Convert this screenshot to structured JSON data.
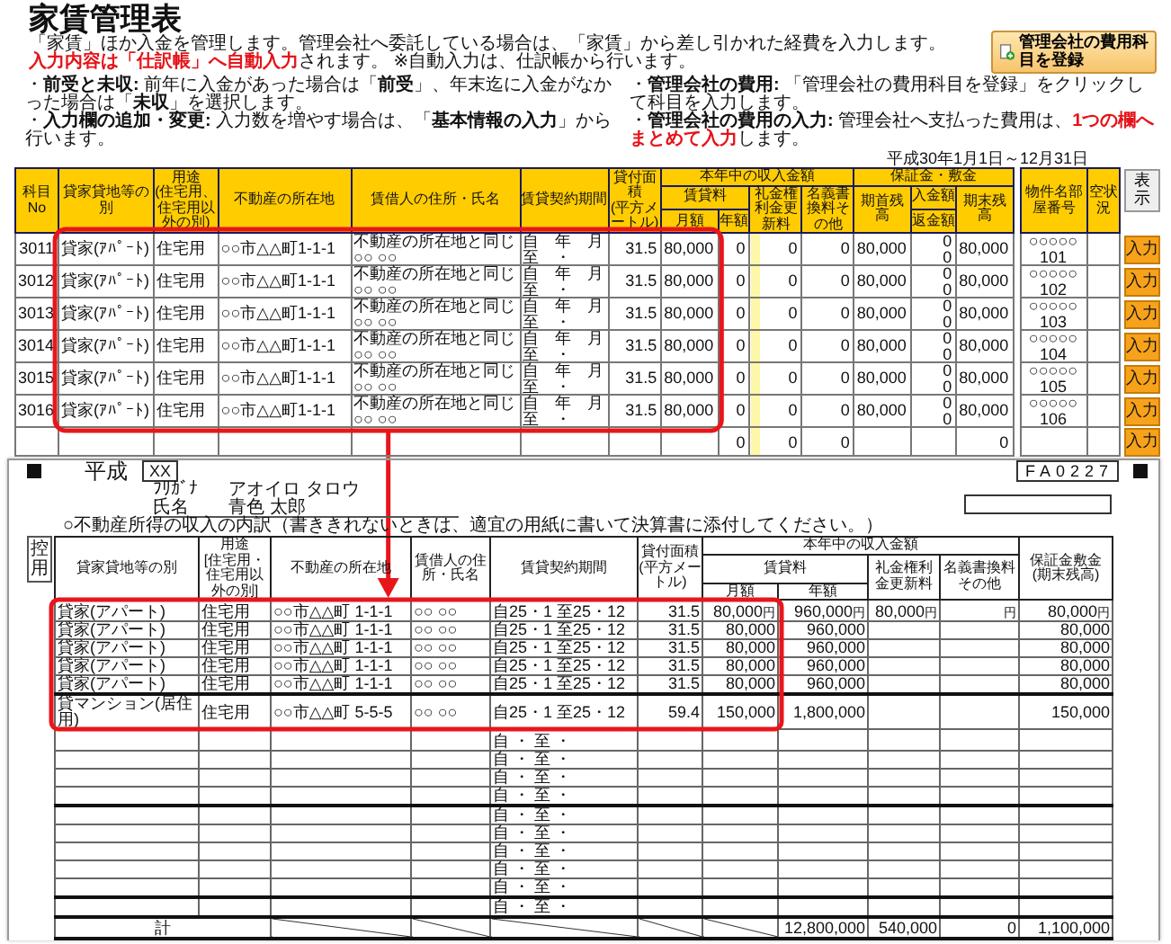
{
  "ledger": {
    "title": "家賃管理表",
    "notes": [
      {
        "text": "「家賃」ほか入金を管理します。管理会社へ委託している場合は、「家賃」から差し引かれた経費を入力します。"
      },
      {
        "emphasis": "入力内容は「仕訳帳」へ自動入力",
        "text": "されます。 ※自動入力は、仕訳帳から行います。"
      }
    ],
    "register_button": "管理会社の費用科目を登録",
    "bullets": [
      {
        "mark": "・",
        "label": "前受と未収:",
        "text": "前年に入金があった場合は「**前受**」、年末迄に入金がなかった場合は「**未収**」を選択します。"
      },
      {
        "mark": "・",
        "label": "入力欄の追加・変更:",
        "text": "入力数を増やす場合は、「**基本情報の入力**」から行います。"
      },
      {
        "mark": "・",
        "label": "管理会社の費用:",
        "text": "「管理会社の費用科目を登録」をクリックして科目を入力します。"
      },
      {
        "mark": "・",
        "label": "管理会社の費用の入力:",
        "text": "管理会社へ支払った費用は、",
        "emphasis": "1つの欄へまとめて入力",
        "text_after": "します。"
      }
    ],
    "period": "平成30年1月1日～12月31日",
    "show_button": "表示",
    "columns": {
      "no": "科目No",
      "type": "貸家貸地等の別",
      "use": "用途",
      "use_note": "(住宅用、住宅用以外の別)",
      "address": "不動産の所在地",
      "tenant": "賃借人の住所・氏名",
      "period": "賃貸契約期間",
      "area": "貸付面積",
      "area_unit": "(平方メートル)",
      "income": "本年中の収入金額",
      "rent": "賃貸料",
      "monthly": "月額",
      "yearly": "年額",
      "key_money": "礼金権利金更新料",
      "transfer_fee": "名義書換料その他",
      "deposit": "保証金・敷金",
      "opening": "期首残高",
      "received": "入金額",
      "refunded": "返金額",
      "closing": "期末残高",
      "property": "物件名部屋番号",
      "vacancy": "空状況"
    },
    "rows": [
      {
        "no": "3011",
        "type": "貸家(ｱﾊﾟｰﾄ)",
        "use": "住宅用",
        "address": "○○市△△町1-1-1",
        "tenant": "不動産の所在地と同じ",
        "tenant_name": "○○ ○○",
        "period_from": "自　年　月",
        "period_to": "至　・",
        "area": "31.5",
        "monthly": "80,000",
        "yearly": "0",
        "key_money": "0",
        "transfer_fee": "0",
        "opening": "80,000",
        "received": "0",
        "refunded": "0",
        "closing": "80,000",
        "property": "○○○○○",
        "room": "101",
        "action": "入力"
      },
      {
        "no": "3012",
        "type": "貸家(ｱﾊﾟｰﾄ)",
        "use": "住宅用",
        "address": "○○市△△町1-1-1",
        "tenant": "不動産の所在地と同じ",
        "tenant_name": "○○ ○○",
        "period_from": "自　年　月",
        "period_to": "至　・",
        "area": "31.5",
        "monthly": "80,000",
        "yearly": "0",
        "key_money": "0",
        "transfer_fee": "0",
        "opening": "80,000",
        "received": "0",
        "refunded": "0",
        "closing": "80,000",
        "property": "○○○○○",
        "room": "102",
        "action": "入力"
      },
      {
        "no": "3013",
        "type": "貸家(ｱﾊﾟｰﾄ)",
        "use": "住宅用",
        "address": "○○市△△町1-1-1",
        "tenant": "不動産の所在地と同じ",
        "tenant_name": "○○ ○○",
        "period_from": "自　年　月",
        "period_to": "至　・",
        "area": "31.5",
        "monthly": "80,000",
        "yearly": "0",
        "key_money": "0",
        "transfer_fee": "0",
        "opening": "80,000",
        "received": "0",
        "refunded": "0",
        "closing": "80,000",
        "property": "○○○○○",
        "room": "103",
        "action": "入力"
      },
      {
        "no": "3014",
        "type": "貸家(ｱﾊﾟｰﾄ)",
        "use": "住宅用",
        "address": "○○市△△町1-1-1",
        "tenant": "不動産の所在地と同じ",
        "tenant_name": "○○ ○○",
        "period_from": "自　年　月",
        "period_to": "至　・",
        "area": "31.5",
        "monthly": "80,000",
        "yearly": "0",
        "key_money": "0",
        "transfer_fee": "0",
        "opening": "80,000",
        "received": "0",
        "refunded": "0",
        "closing": "80,000",
        "property": "○○○○○",
        "room": "104",
        "action": "入力"
      },
      {
        "no": "3015",
        "type": "貸家(ｱﾊﾟｰﾄ)",
        "use": "住宅用",
        "address": "○○市△△町1-1-1",
        "tenant": "不動産の所在地と同じ",
        "tenant_name": "○○ ○○",
        "period_from": "自　年　月",
        "period_to": "至　・",
        "area": "31.5",
        "monthly": "80,000",
        "yearly": "0",
        "key_money": "0",
        "transfer_fee": "0",
        "opening": "80,000",
        "received": "0",
        "refunded": "0",
        "closing": "80,000",
        "property": "○○○○○",
        "room": "105",
        "action": "入力"
      },
      {
        "no": "3016",
        "type": "貸家(ｱﾊﾟｰﾄ)",
        "use": "住宅用",
        "address": "○○市△△町1-1-1",
        "tenant": "不動産の所在地と同じ",
        "tenant_name": "○○ ○○",
        "period_from": "自　年　月",
        "period_to": "至　・",
        "area": "31.5",
        "monthly": "80,000",
        "yearly": "0",
        "key_money": "0",
        "transfer_fee": "0",
        "opening": "80,000",
        "received": "0",
        "refunded": "0",
        "closing": "80,000",
        "property": "○○○○○",
        "room": "106",
        "action": "入力"
      },
      {
        "yearly": "0",
        "key_money": "0",
        "transfer_fee": "0",
        "closing": "0",
        "action": "入力"
      }
    ]
  },
  "form": {
    "era": "平成",
    "year": "XX",
    "code": "FA0227",
    "furigana_label": "ﾌﾘｶﾞﾅ",
    "furigana": "アオイロ タロウ",
    "name_label": "氏名",
    "name": "青色 太郎",
    "note": "○不動産所得の収入の内訳（書ききれないときは、適宜の用紙に書いて決算書に添付してください。）",
    "copy_label": "控用",
    "columns": {
      "type": "貸家貸地等の別",
      "use": "用途",
      "use_note": "[住宅用・住宅用以外の別]",
      "address": "不動産の所在地",
      "tenant": "賃借人の住所・氏名",
      "period": "賃貸契約期間",
      "area": "貸付面積",
      "area_unit": "(平方メートル)",
      "income": "本年中の収入金額",
      "rent": "賃貸料",
      "monthly": "月額",
      "yearly": "年額",
      "key_money": "礼金権利金更新料",
      "other": "名義書換料その他",
      "deposit": "保証金敷金",
      "deposit_note": "(期末残高)"
    },
    "rows": [
      {
        "type": "貸家(アパート)",
        "use": "住宅用",
        "address": "○○市△△町 1-1-1",
        "tenant": "○○ ○○",
        "period": "自25・1 至25・12",
        "area": "31.5",
        "monthly": "80,000",
        "yearly": "960,000",
        "key_money": "80,000",
        "deposit": "80,000",
        "monthly_unit": "円",
        "yearly_unit": "円",
        "key_money_unit": "円",
        "other_unit": "円",
        "deposit_unit": "円"
      },
      {
        "type": "貸家(アパート)",
        "use": "住宅用",
        "address": "○○市△△町 1-1-1",
        "tenant": "○○ ○○",
        "period": "自25・1 至25・12",
        "area": "31.5",
        "monthly": "80,000",
        "yearly": "960,000",
        "deposit": "80,000"
      },
      {
        "type": "貸家(アパート)",
        "use": "住宅用",
        "address": "○○市△△町 1-1-1",
        "tenant": "○○ ○○",
        "period": "自25・1 至25・12",
        "area": "31.5",
        "monthly": "80,000",
        "yearly": "960,000",
        "deposit": "80,000"
      },
      {
        "type": "貸家(アパート)",
        "use": "住宅用",
        "address": "○○市△△町 1-1-1",
        "tenant": "○○ ○○",
        "period": "自25・1 至25・12",
        "area": "31.5",
        "monthly": "80,000",
        "yearly": "960,000",
        "deposit": "80,000"
      },
      {
        "type": "貸家(アパート)",
        "use": "住宅用",
        "address": "○○市△△町 1-1-1",
        "tenant": "○○ ○○",
        "period": "自25・1 至25・12",
        "area": "31.5",
        "monthly": "80,000",
        "yearly": "960,000",
        "deposit": "80,000"
      },
      {
        "type": "貸マンション(居住用)",
        "use": "住宅用",
        "address": "○○市△△町 5-5-5",
        "tenant": "○○ ○○",
        "period": "自25・1 至25・12",
        "area": "59.4",
        "monthly": "150,000",
        "yearly": "1,800,000",
        "deposit": "150,000"
      },
      {
        "period": "自 ・ 至 ・"
      },
      {
        "period": "自 ・ 至 ・"
      },
      {
        "period": "自 ・ 至 ・"
      },
      {
        "period": "自 ・ 至 ・"
      },
      {
        "period": "自 ・ 至 ・"
      },
      {
        "period": "自 ・ 至 ・"
      },
      {
        "period": "自 ・ 至 ・"
      },
      {
        "period": "自 ・ 至 ・"
      },
      {
        "period": "自 ・ 至 ・"
      },
      {
        "period": "自 ・ 至 ・"
      }
    ],
    "total": {
      "label": "計",
      "yearly": "12,800,000",
      "key_money": "540,000",
      "other": "0",
      "deposit": "1,100,000"
    }
  }
}
